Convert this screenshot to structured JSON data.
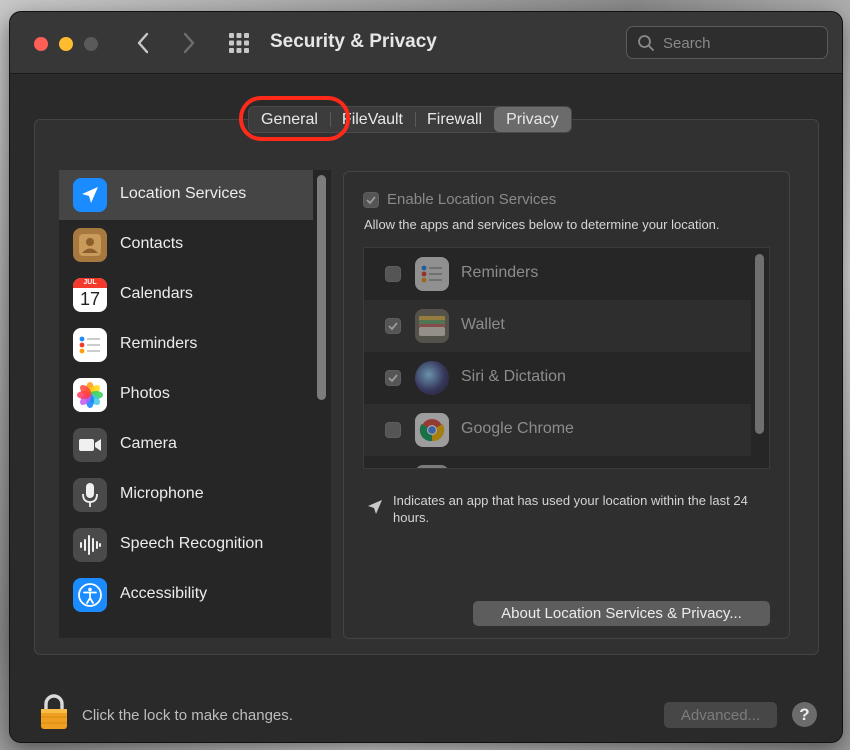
{
  "window": {
    "title": "Security & Privacy",
    "search": {
      "placeholder": "Search",
      "value": ""
    }
  },
  "tabs": [
    {
      "label": "General",
      "active": false,
      "highlighted": true
    },
    {
      "label": "FileVault",
      "active": false
    },
    {
      "label": "Firewall",
      "active": false
    },
    {
      "label": "Privacy",
      "active": true
    }
  ],
  "sidebar": {
    "items": [
      {
        "label": "Location Services",
        "icon": "location-arrow-icon",
        "selected": true
      },
      {
        "label": "Contacts",
        "icon": "contacts-book-icon"
      },
      {
        "label": "Calendars",
        "icon": "calendar-icon",
        "icon_month": "JUL",
        "icon_day": "17"
      },
      {
        "label": "Reminders",
        "icon": "reminders-list-icon"
      },
      {
        "label": "Photos",
        "icon": "photos-flower-icon"
      },
      {
        "label": "Camera",
        "icon": "camera-icon"
      },
      {
        "label": "Microphone",
        "icon": "microphone-icon"
      },
      {
        "label": "Speech Recognition",
        "icon": "speech-waveform-icon"
      },
      {
        "label": "Accessibility",
        "icon": "accessibility-person-icon"
      }
    ]
  },
  "location": {
    "enable_label": "Enable Location Services",
    "enable_checked": true,
    "allow_text": "Allow the apps and services below to determine your location.",
    "apps": [
      {
        "name": "Reminders",
        "checked": false,
        "icon": "reminders-list-icon"
      },
      {
        "name": "Wallet",
        "checked": true,
        "icon": "wallet-icon"
      },
      {
        "name": "Siri & Dictation",
        "checked": true,
        "icon": "siri-orb-icon"
      },
      {
        "name": "Google Chrome",
        "checked": false,
        "icon": "chrome-icon"
      }
    ],
    "note": "Indicates an app that has used your location within the last 24 hours.",
    "about_button": "About Location Services & Privacy..."
  },
  "footer": {
    "lock_text": "Click the lock to make changes.",
    "advanced_button": "Advanced...",
    "help_label": "?"
  },
  "colors": {
    "highlight_ring": "#ff2a1a",
    "location_blue": "#1a8cff"
  }
}
